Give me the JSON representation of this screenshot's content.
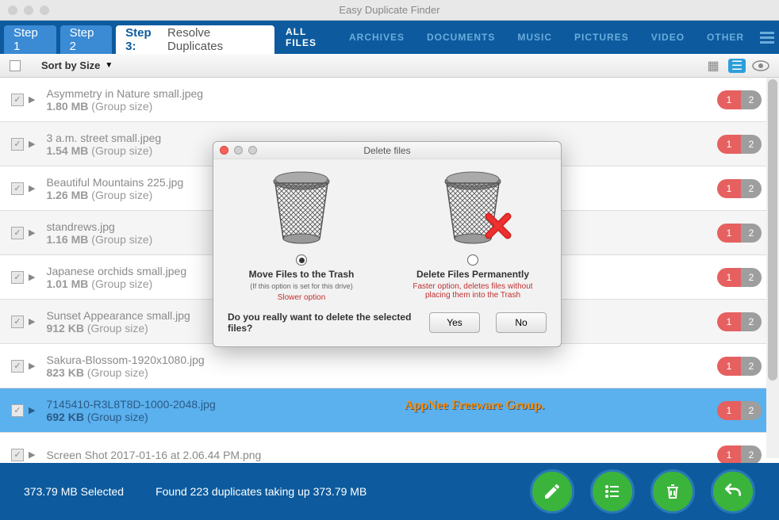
{
  "titlebar": {
    "title": "Easy Duplicate Finder"
  },
  "steps": {
    "step1": "Step 1",
    "step2": "Step 2",
    "step3_label": "Step 3:",
    "step3_desc": "Resolve Duplicates"
  },
  "filters": [
    "ALL FILES",
    "ARCHIVES",
    "DOCUMENTS",
    "MUSIC",
    "PICTURES",
    "VIDEO",
    "OTHER"
  ],
  "sort": {
    "label": "Sort by Size"
  },
  "files": [
    {
      "name": "Asymmetry in Nature small.jpeg",
      "size": "1.80 MB",
      "size_suffix": "(Group size)",
      "b1": "1",
      "b2": "2"
    },
    {
      "name": "3 a.m. street small.jpeg",
      "size": "1.54 MB",
      "size_suffix": "(Group size)",
      "b1": "1",
      "b2": "2"
    },
    {
      "name": "Beautiful Mountains 225.jpg",
      "size": "1.26 MB",
      "size_suffix": "(Group size)",
      "b1": "1",
      "b2": "2"
    },
    {
      "name": "standrews.jpg",
      "size": "1.16 MB",
      "size_suffix": "(Group size)",
      "b1": "1",
      "b2": "2"
    },
    {
      "name": "Japanese orchids small.jpeg",
      "size": "1.01 MB",
      "size_suffix": "(Group size)",
      "b1": "1",
      "b2": "2"
    },
    {
      "name": "Sunset Appearance small.jpg",
      "size": "912 KB",
      "size_suffix": "(Group size)",
      "b1": "1",
      "b2": "2"
    },
    {
      "name": "Sakura-Blossom-1920x1080.jpg",
      "size": "823 KB",
      "size_suffix": "(Group size)",
      "b1": "1",
      "b2": "2"
    },
    {
      "name": "7145410-R3L8T8D-1000-2048.jpg",
      "size": "692 KB",
      "size_suffix": "(Group size)",
      "b1": "1",
      "b2": "2"
    },
    {
      "name": "Screen Shot 2017-01-16 at 2.06.44 PM.png",
      "size": "",
      "size_suffix": "",
      "b1": "1",
      "b2": "2"
    }
  ],
  "bottom": {
    "selected": "373.79 MB Selected",
    "found": "Found 223 duplicates taking up 373.79 MB"
  },
  "dialog": {
    "title": "Delete files",
    "opt1_title": "Move Files to the Trash",
    "opt1_sub": "(If this option is set for this drive)",
    "opt1_note": "Slower option",
    "opt2_title": "Delete Files Permanently",
    "opt2_note": "Faster option, deletes files without placing them into the Trash",
    "confirm": "Do you really want to delete the selected files?",
    "yes": "Yes",
    "no": "No"
  },
  "watermark": "AppNee Freeware Group."
}
